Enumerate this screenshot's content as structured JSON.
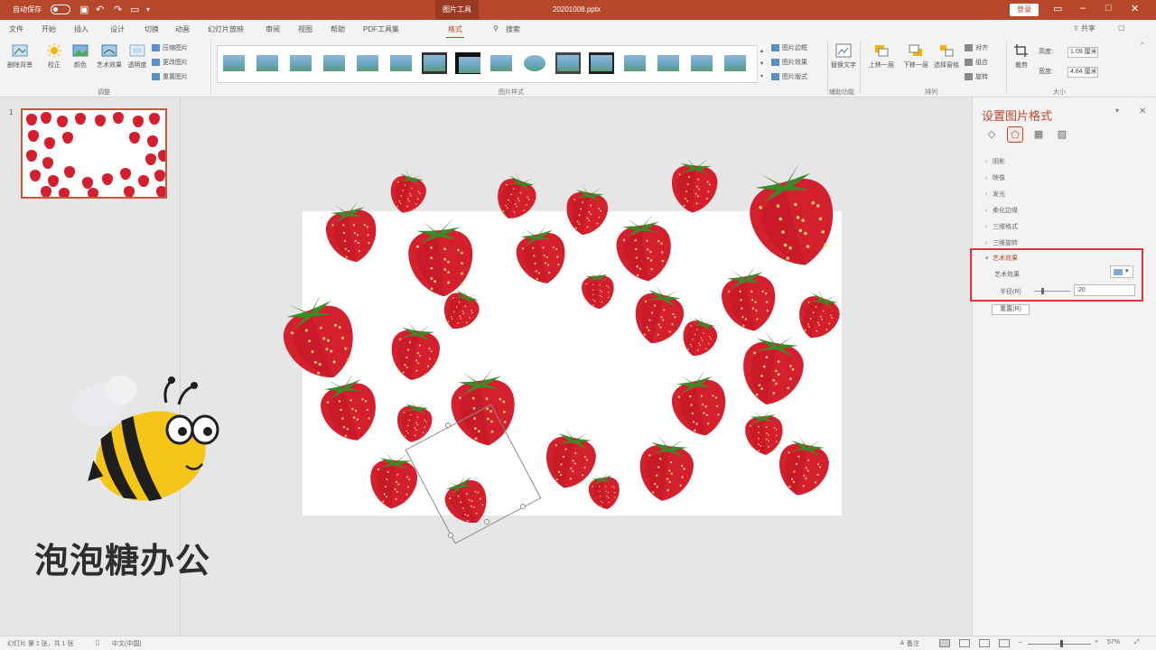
{
  "titlebar": {
    "autosave_label": "自动保存",
    "toggle_state": "关",
    "context_tab": "图片工具",
    "filename": "20201008.pptx",
    "signin": "登录"
  },
  "tabs": [
    "文件",
    "开始",
    "插入",
    "设计",
    "切换",
    "动画",
    "幻灯片放映",
    "审阅",
    "视图",
    "帮助",
    "PDF工具集",
    "格式"
  ],
  "tabs_search": "搜索",
  "share_label": "共享",
  "ribbon": {
    "adjust": {
      "buttons": [
        "删除背景",
        "校正",
        "颜色",
        "艺术效果",
        "透明度"
      ],
      "small": [
        "压缩图片",
        "更改图片",
        "重置图片"
      ],
      "label": "调整"
    },
    "styles": {
      "label": "图片样式",
      "small": [
        "图片边框",
        "图片效果",
        "图片版式"
      ]
    },
    "accessibility": {
      "button": "替换文字",
      "label": "辅助功能"
    },
    "arrange": {
      "buttons": [
        "上移一层",
        "下移一层",
        "选择窗格"
      ],
      "small": [
        "对齐",
        "组合",
        "旋转"
      ],
      "label": "排列"
    },
    "size": {
      "crop": "裁剪",
      "height_label": "高度:",
      "height_value": "1.09 厘米",
      "width_label": "宽度:",
      "width_value": "4.84 厘米",
      "label": "大小"
    }
  },
  "thumbpane": {
    "slide_number": "1"
  },
  "logo": {
    "text": "泡泡糖办公"
  },
  "format_pane": {
    "title": "设置图片格式",
    "sections": [
      "阴影",
      "映像",
      "发光",
      "柔化边缘",
      "三维格式",
      "三维旋转"
    ],
    "art_section": "艺术效果",
    "art_label": "艺术效果",
    "radius_label": "半径(R)",
    "radius_value": "20",
    "reset_button": "重置(R)"
  },
  "statusbar": {
    "slide_info": "幻灯片 第 1 张，共 1 张",
    "language": "中文(中国)",
    "notes": "备注",
    "zoom": "57%"
  },
  "colors": {
    "accent": "#b7472a",
    "highlight_box": "#d9363e",
    "strawberry": "#d4202e"
  }
}
